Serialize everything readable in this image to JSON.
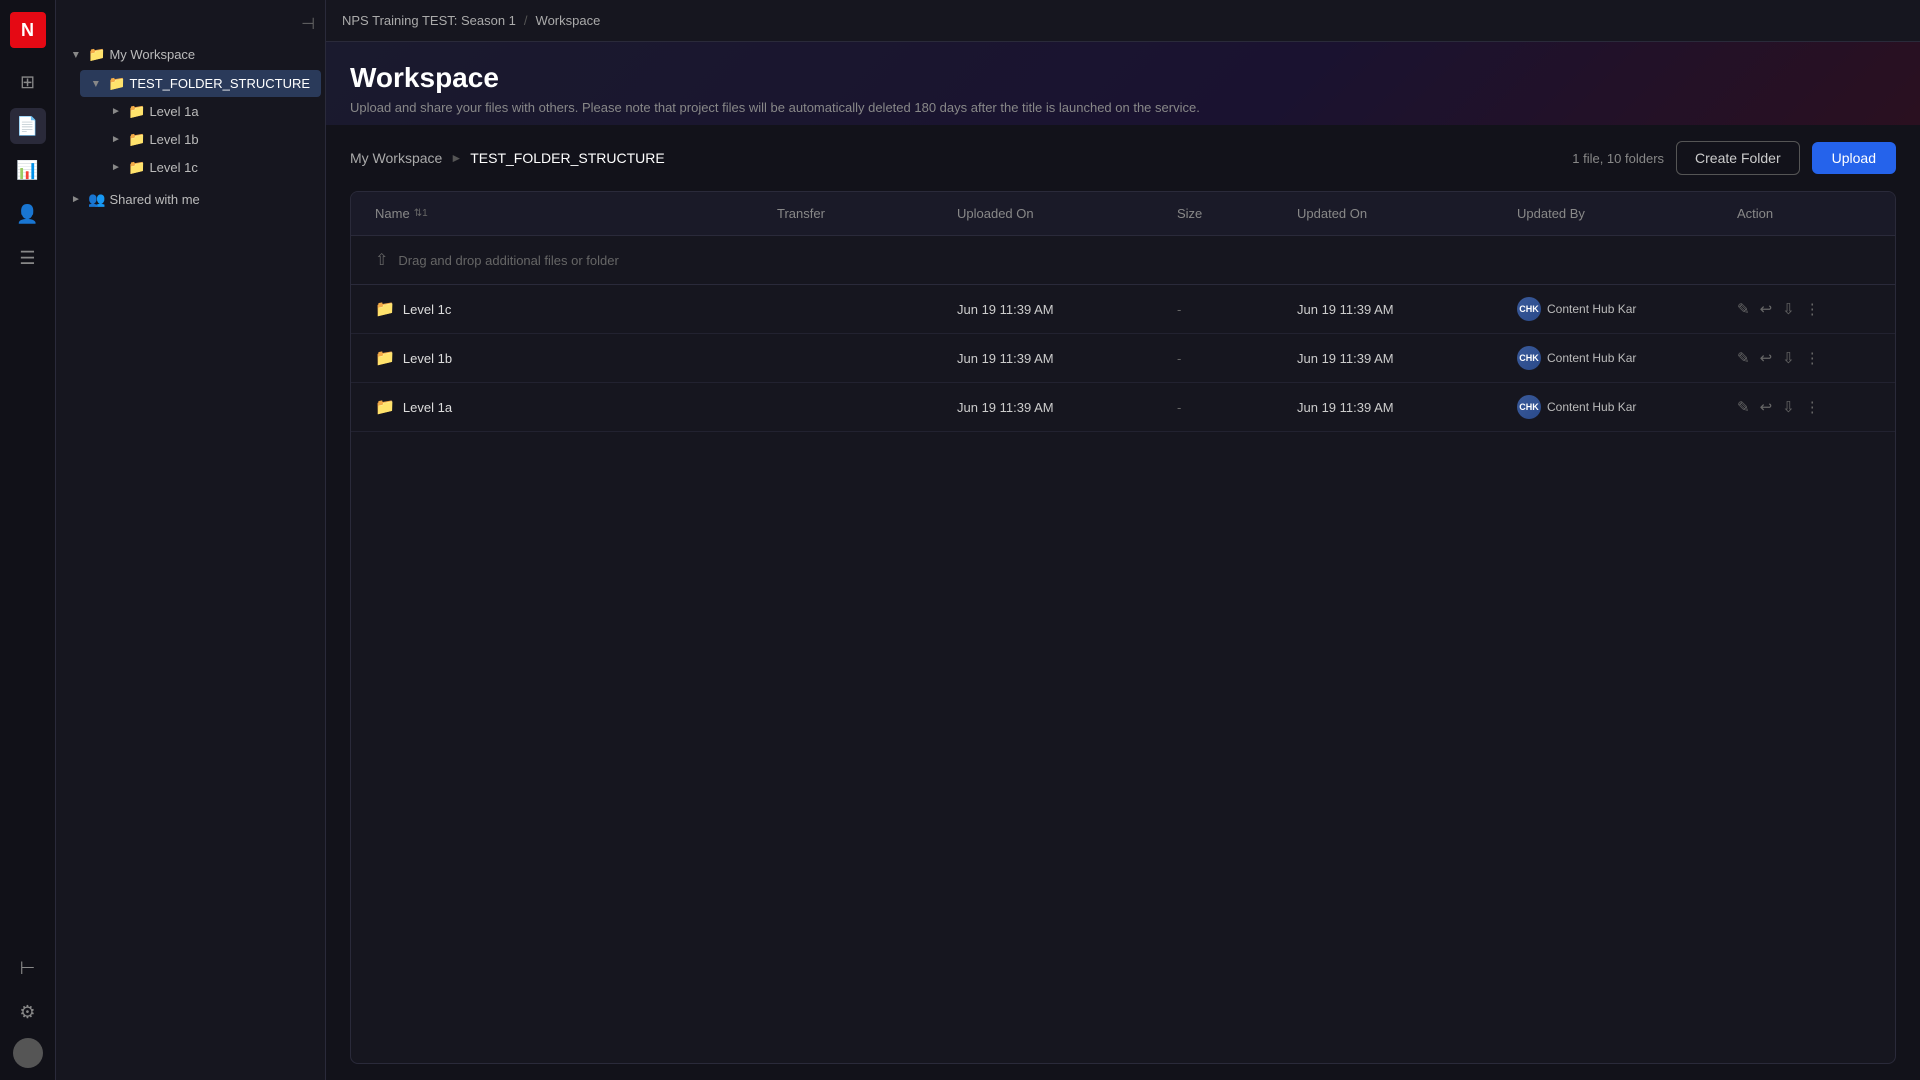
{
  "app": {
    "logo": "N",
    "title": "Workspace"
  },
  "topbar": {
    "breadcrumb": [
      {
        "label": "NPS Training TEST: Season 1",
        "link": true
      },
      {
        "label": "Workspace",
        "link": true
      }
    ]
  },
  "header": {
    "title": "Workspace",
    "subtitle": "Upload and share your files with others. Please note that project files will be automatically deleted 180 days after the title is launched on the service."
  },
  "breadcrumb": {
    "items": [
      "My Workspace"
    ],
    "current": "TEST_FOLDER_STRUCTURE"
  },
  "file_count": "1 file, 10 folders",
  "buttons": {
    "create_folder": "Create Folder",
    "upload": "Upload"
  },
  "table": {
    "columns": [
      {
        "key": "name",
        "label": "Name",
        "sortable": true,
        "sort_indicator": "⇅1"
      },
      {
        "key": "transfer",
        "label": "Transfer",
        "sortable": false
      },
      {
        "key": "uploaded_on",
        "label": "Uploaded On",
        "sortable": false
      },
      {
        "key": "size",
        "label": "Size",
        "sortable": false
      },
      {
        "key": "updated_on",
        "label": "Updated On",
        "sortable": false
      },
      {
        "key": "updated_by",
        "label": "Updated By",
        "sortable": false
      },
      {
        "key": "action",
        "label": "Action",
        "sortable": false
      }
    ],
    "drop_zone_text": "Drag and drop additional files or folder",
    "rows": [
      {
        "name": "Level 1c",
        "type": "folder",
        "transfer": "",
        "uploaded_on": "Jun 19 11:39 AM",
        "size": "-",
        "updated_on": "Jun 19 11:39 AM",
        "updated_by": "Content Hub Kar",
        "updated_by_initials": "CHK"
      },
      {
        "name": "Level 1b",
        "type": "folder",
        "transfer": "",
        "uploaded_on": "Jun 19 11:39 AM",
        "size": "-",
        "updated_on": "Jun 19 11:39 AM",
        "updated_by": "Content Hub Kar",
        "updated_by_initials": "CHK"
      },
      {
        "name": "Level 1a",
        "type": "folder",
        "transfer": "",
        "uploaded_on": "Jun 19 11:39 AM",
        "size": "-",
        "updated_on": "Jun 19 11:39 AM",
        "updated_by": "Content Hub Kar",
        "updated_by_initials": "CHK"
      }
    ]
  },
  "sidebar": {
    "collapse_icon": "⊣",
    "tree": {
      "root": {
        "label": "My Workspace",
        "expanded": true,
        "children": [
          {
            "label": "TEST_FOLDER_STRUCTURE",
            "expanded": true,
            "active": true,
            "children": [
              {
                "label": "Level 1a",
                "expanded": false,
                "children": []
              },
              {
                "label": "Level 1b",
                "expanded": false,
                "children": []
              },
              {
                "label": "Level 1c",
                "expanded": false,
                "children": []
              }
            ]
          }
        ]
      },
      "shared": {
        "label": "Shared with me",
        "expanded": false
      }
    }
  },
  "rail": {
    "icons": [
      {
        "name": "grid-icon",
        "symbol": "⊞",
        "active": false
      },
      {
        "name": "file-icon",
        "symbol": "🗋",
        "active": true
      },
      {
        "name": "chart-icon",
        "symbol": "📊",
        "active": false
      },
      {
        "name": "person-icon",
        "symbol": "👤",
        "active": false
      },
      {
        "name": "list-icon",
        "symbol": "☰",
        "active": false
      }
    ],
    "bottom_icons": [
      {
        "name": "expand-icon",
        "symbol": "⊢"
      },
      {
        "name": "settings-icon",
        "symbol": "⚙"
      }
    ]
  }
}
